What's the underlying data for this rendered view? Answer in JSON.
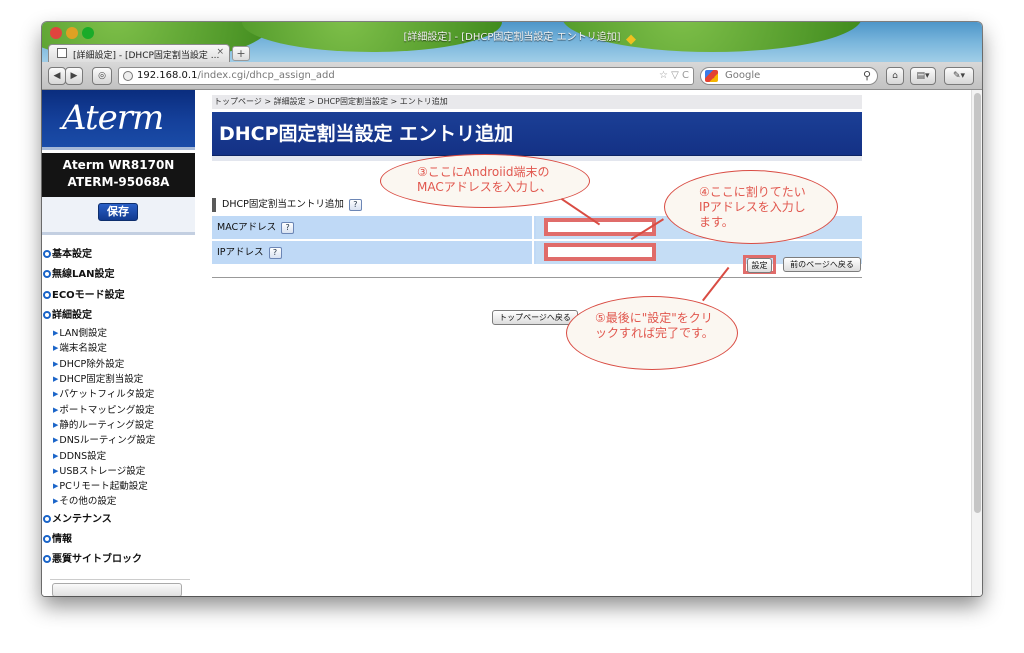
{
  "browser": {
    "window_title": "[詳細設定] - [DHCP固定割当設定 エントリ追加]",
    "tab_label": "[詳細設定] - [DHCP固定割当設定 ...",
    "tab_close": "×",
    "new_tab": "+",
    "url_host": "192.168.0.1",
    "url_path": "/index.cgi/dhcp_assign_add",
    "url_right": "☆ ▽ C",
    "search_placeholder": "Google",
    "nav_back": "◀",
    "nav_forward": "▶",
    "home": "⌂"
  },
  "sidebar": {
    "brand": "Aterm",
    "model_line1": "Aterm  WR8170N",
    "model_line2": "ATERM-95068A",
    "save_label": "保存",
    "menu": [
      {
        "label": "基本設定",
        "type": "header"
      },
      {
        "label": "無線LAN設定",
        "type": "header"
      },
      {
        "label": "ECOモード設定",
        "type": "header"
      },
      {
        "label": "詳細設定",
        "type": "header"
      },
      {
        "label": "LAN側設定",
        "type": "sub"
      },
      {
        "label": "端末名設定",
        "type": "sub"
      },
      {
        "label": "DHCP除外設定",
        "type": "sub"
      },
      {
        "label": "DHCP固定割当設定",
        "type": "sub"
      },
      {
        "label": "パケットフィルタ設定",
        "type": "sub"
      },
      {
        "label": "ポートマッピング設定",
        "type": "sub"
      },
      {
        "label": "静的ルーティング設定",
        "type": "sub"
      },
      {
        "label": "DNSルーティング設定",
        "type": "sub"
      },
      {
        "label": "DDNS設定",
        "type": "sub"
      },
      {
        "label": "USBストレージ設定",
        "type": "sub"
      },
      {
        "label": "PCリモート起動設定",
        "type": "sub"
      },
      {
        "label": "その他の設定",
        "type": "sub"
      },
      {
        "label": "メンテナンス",
        "type": "header"
      },
      {
        "label": "情報",
        "type": "header"
      },
      {
        "label": "悪質サイトブロック",
        "type": "header"
      }
    ]
  },
  "main": {
    "breadcrumb": "トップページ > 詳細設定 > DHCP固定割当設定 > エントリ追加",
    "page_title": "DHCP固定割当設定 エントリ追加",
    "section_title": "DHCP固定割当エントリ追加",
    "help": "?",
    "fields": [
      {
        "label": "MACアドレス",
        "value": ""
      },
      {
        "label": "IPアドレス",
        "value": ""
      }
    ],
    "set_button": "設定",
    "back_button": "前のページへ戻る",
    "top_button": "トップページへ戻る"
  },
  "annotations": {
    "step3": "③ここにAndroiid端末のMACアドレスを入力し、",
    "step4": "④ここに割りてたいIPアドレスを入力します。",
    "step5": "⑤最後に\"設定\"をクリックすれば完了です。"
  },
  "colors": {
    "header_blue": "#143185",
    "row_blue": "#bfd9f6",
    "annotation_red": "#e06c6a"
  }
}
